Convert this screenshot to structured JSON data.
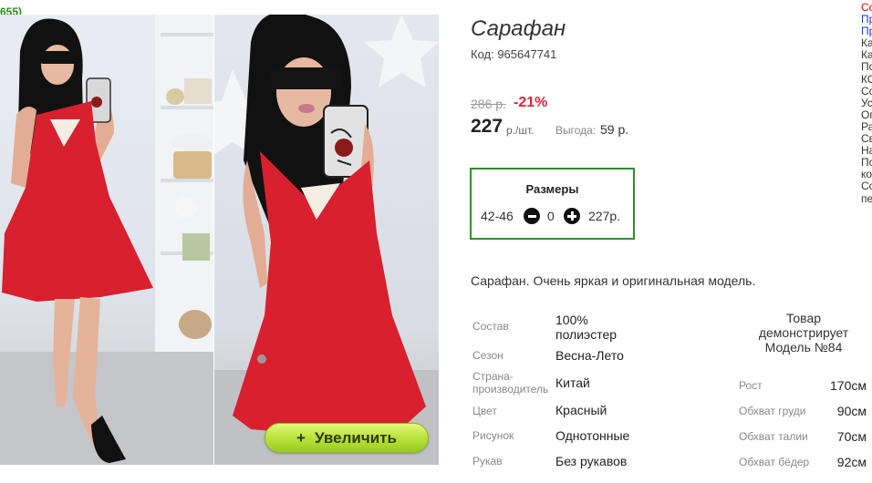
{
  "header": {
    "counter": "655)"
  },
  "product": {
    "title": "Сарафан",
    "code": "Код: 965647741",
    "old_price": "286 р.",
    "discount": "-21%",
    "price": "227",
    "price_unit": "р./шт.",
    "benefit_label": "Выгода:",
    "benefit_value": "59 р.",
    "description": "Сарафан. Очень яркая и оригинальная модель."
  },
  "sizes": {
    "title": "Размеры",
    "items": [
      {
        "label": "42-46",
        "quantity": "0",
        "price": "227р."
      }
    ]
  },
  "gallery": {
    "zoom_label": "Увеличить",
    "zoom_icon": "plus-icon"
  },
  "attributes": [
    {
      "label": "Состав",
      "value": "100% полиэстер"
    },
    {
      "label": "Сезон",
      "value": "Весна-Лето"
    },
    {
      "label": "Страна-производитель",
      "value": "Китай"
    },
    {
      "label": "Цвет",
      "value": "Красный"
    },
    {
      "label": "Рисунок",
      "value": "Однотонные"
    },
    {
      "label": "Рукав",
      "value": "Без рукавов"
    }
  ],
  "model": {
    "caption": "Товар демонстрирует Модель №84",
    "measurements": [
      {
        "label": "Рост",
        "value": "170см"
      },
      {
        "label": "Обхват груди",
        "value": "90см"
      },
      {
        "label": "Обхват талии",
        "value": "70см"
      },
      {
        "label": "Обхват бёдер",
        "value": "92см"
      }
    ]
  },
  "side_links": [
    {
      "text": "Со",
      "color": "red"
    },
    {
      "text": "Пр",
      "color": "blue"
    },
    {
      "text": "Пр",
      "color": "blue"
    },
    {
      "text": "Ка",
      "color": "default"
    },
    {
      "text": "Ка",
      "color": "default"
    },
    {
      "text": "По",
      "color": "default"
    },
    {
      "text": "КО",
      "color": "default"
    },
    {
      "text": "Со",
      "color": "default"
    },
    {
      "text": "Ус",
      "color": "default"
    },
    {
      "text": "Оп",
      "color": "default"
    },
    {
      "text": "Ра",
      "color": "default"
    },
    {
      "text": "Св",
      "color": "default"
    },
    {
      "text": "На",
      "color": "default"
    },
    {
      "text": "По",
      "color": "default"
    },
    {
      "text": "ко",
      "color": "default"
    },
    {
      "text": "Со",
      "color": "default"
    },
    {
      "text": "пе",
      "color": "default"
    }
  ],
  "colors": {
    "accent_green": "#2f8f2a",
    "discount_red": "#e8203a",
    "dress_red": "#d8202e",
    "zoom_button": "#b9e33a"
  }
}
